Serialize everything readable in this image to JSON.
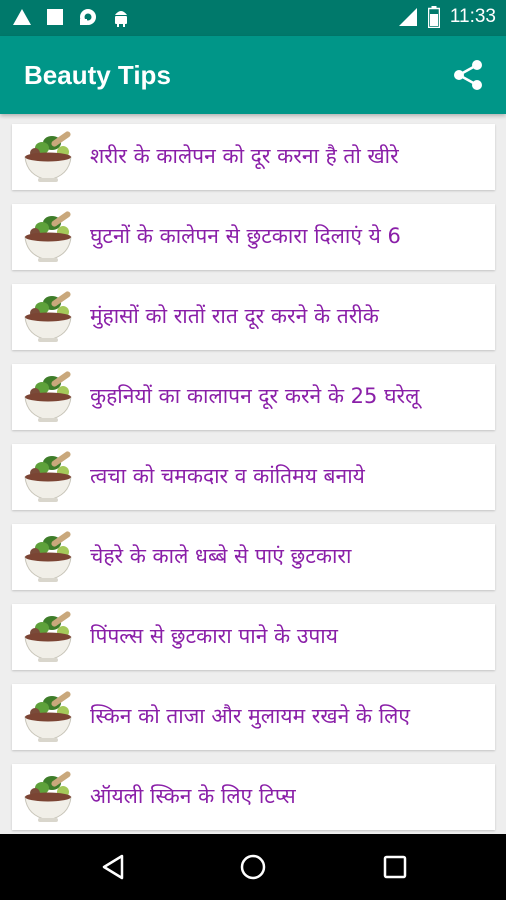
{
  "status_bar": {
    "time": "11:33",
    "left_icons": [
      "warning-triangle-icon",
      "stop-square-icon",
      "sync-icon",
      "android-icon"
    ],
    "right_icons": [
      "signal-icon",
      "battery-icon"
    ]
  },
  "app_bar": {
    "title": "Beauty Tips",
    "share_icon": "share-icon",
    "color": "#009688"
  },
  "list": {
    "text_color": "#8a1fa8",
    "items": [
      {
        "title": "शरीर के  कालेपन को दूर करना है तो खीरे",
        "icon": "mortar-pestle-icon"
      },
      {
        "title": "घुटनों के  कालेपन से छुटकारा दिलाएं ये 6",
        "icon": "mortar-pestle-icon"
      },
      {
        "title": "मुंहासों को रातों रात दूर करने के   तरीके",
        "icon": "mortar-pestle-icon"
      },
      {
        "title": "कुहनियों का कालापन दूर करने के  25 घरेलू",
        "icon": "mortar-pestle-icon"
      },
      {
        "title": "त्वचा को चमकदार व कांतिमय  बनाये",
        "icon": "mortar-pestle-icon"
      },
      {
        "title": "चेहरे के  काले धब्बे से पाएं छुटकारा",
        "icon": "mortar-pestle-icon"
      },
      {
        "title": "पिंपल्स से छुटकारा पाने के  उपाय",
        "icon": "mortar-pestle-icon"
      },
      {
        "title": "स्किन को ताजा और मुलायम रखने के  लिए",
        "icon": "mortar-pestle-icon"
      },
      {
        "title": "ऑयली स्किन के  लिए टिप्स",
        "icon": "mortar-pestle-icon"
      }
    ]
  },
  "nav_bar": {
    "buttons": [
      "back-icon",
      "home-icon",
      "recents-icon"
    ]
  }
}
